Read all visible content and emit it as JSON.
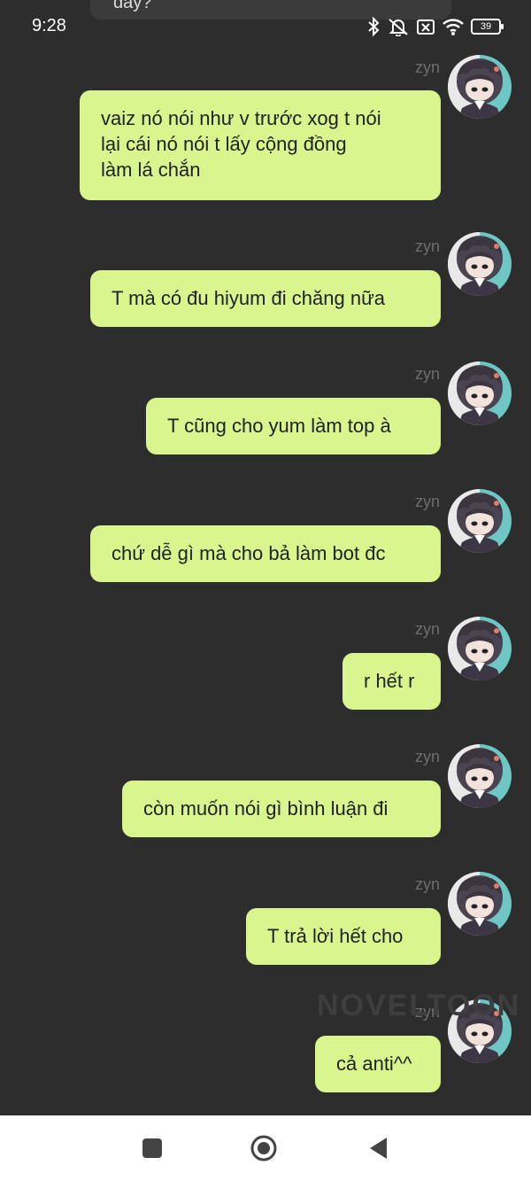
{
  "status_bar": {
    "time": "9:28",
    "battery": "39",
    "icons": [
      "bluetooth-icon",
      "vibrate-off-icon",
      "sim-off-icon",
      "wifi-icon",
      "battery-icon"
    ]
  },
  "previous_message_fragment": "đấy?",
  "messages": [
    {
      "sender": "zyn",
      "text": "vaiz nó nói như v trước xog t nói\nlại cái nó nói t lấy cộng đồng\nlàm lá chắn"
    },
    {
      "sender": "zyn",
      "text": "T mà có đu hiyum đi chăng nữa"
    },
    {
      "sender": "zyn",
      "text": "T cũng cho yum làm top à"
    },
    {
      "sender": "zyn",
      "text": "chứ dễ gì mà cho bả làm bot đc"
    },
    {
      "sender": "zyn",
      "text": "r hết r"
    },
    {
      "sender": "zyn",
      "text": "còn muốn nói gì bình luận đi"
    },
    {
      "sender": "zyn",
      "text": "T trả lời hết cho"
    },
    {
      "sender": "zyn",
      "text": "cả anti^^"
    }
  ],
  "watermark": "NOVELTOON",
  "nav_bar": {
    "buttons": [
      "recents-square-icon",
      "home-circle-icon",
      "back-triangle-icon"
    ]
  },
  "colors": {
    "background": "#2d2d2d",
    "bubble": "#d9f58e",
    "sender": "#6e6e6e",
    "nav": "#ffffff"
  }
}
